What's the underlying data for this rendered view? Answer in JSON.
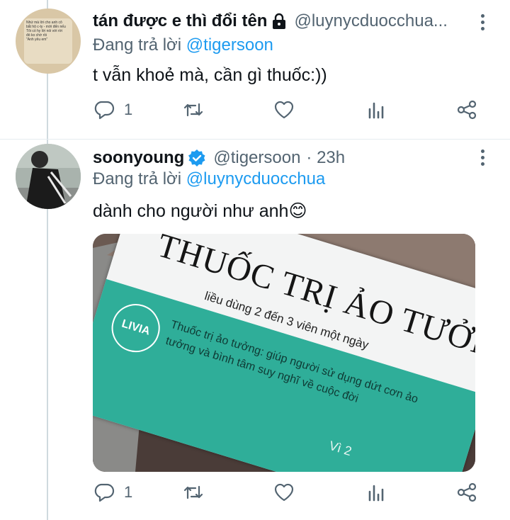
{
  "tweets": [
    {
      "author_name": "tán được e thì đổi tên",
      "handle": "@luynycduocchua...",
      "replying_label": "Đang trả lời",
      "replying_to": "@tigersoon",
      "text": "t vẫn khoẻ mà, cần gì thuốc:))",
      "reply_count": "1",
      "avatar_mini_text": [
        "Nhứ mà lời cho anh cô",
        "bắt hộ c-ty - mời đến nếu",
        "Tôi có hy lời nói với rời",
        "đó ko chờ rồi",
        "\"Anh yêu em\""
      ],
      "icons": [
        "lock-icon",
        "more-icon",
        "reply-icon",
        "retweet-icon",
        "like-icon",
        "analytics-icon",
        "share-icon"
      ]
    },
    {
      "author_name": "soonyoung",
      "handle": "@tigersoon",
      "time": "· 23h",
      "replying_label": "Đang trả lời",
      "replying_to": "@luynycduocchua",
      "text": "dành cho người như anh",
      "emoji": "😊",
      "reply_count": "1",
      "media": {
        "box_title": "THUỐC TRỊ ẢO TƯỞNG",
        "dosage": "liều dùng 2 đến 3 viên một ngày",
        "brand": "LIVIA",
        "description_1": "Thuốc trị ảo tưởng: giúp người sử dụng dứt cơn ảo",
        "description_2": "tưởng và bình tâm suy nghĩ về cuộc đời",
        "partial": "Vì 2"
      },
      "icons": [
        "verified-badge-icon",
        "more-icon",
        "reply-icon",
        "retweet-icon",
        "like-icon",
        "analytics-icon",
        "share-icon"
      ]
    }
  ],
  "colors": {
    "accent": "#1d9bf0",
    "muted": "#536471",
    "teal": "#2fae99"
  }
}
